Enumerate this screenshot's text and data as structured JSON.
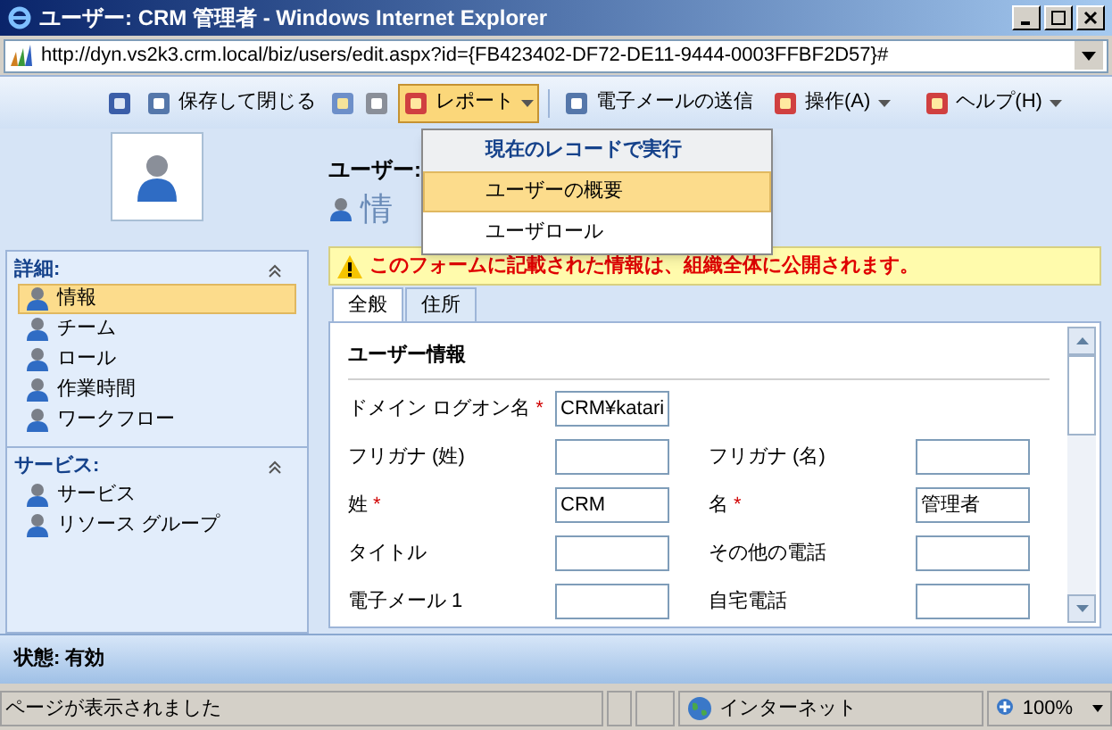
{
  "window": {
    "title": "ユーザー: CRM 管理者 - Windows Internet Explorer"
  },
  "address_bar": {
    "url": "http://dyn.vs2k3.crm.local/biz/users/edit.aspx?id={FB423402-DF72-DE11-9444-0003FFBF2D57}#"
  },
  "toolbar": {
    "items": [
      {
        "kind": "button",
        "label": "保存して閉じる",
        "active": false
      },
      {
        "kind": "dropdown",
        "label": "レポート",
        "active": true
      },
      {
        "kind": "button",
        "label": "電子メールの送信",
        "active": false
      },
      {
        "kind": "dropdown",
        "label": "操作(A)",
        "active": false
      },
      {
        "kind": "dropdown",
        "label": "ヘルプ(H)",
        "active": false
      }
    ]
  },
  "report_menu": {
    "items": [
      {
        "kind": "header",
        "label": "現在のレコードで実行",
        "selected": false
      },
      {
        "kind": "item",
        "label": "ユーザーの概要",
        "selected": true
      },
      {
        "kind": "item",
        "label": "ユーザロール",
        "selected": false
      }
    ]
  },
  "page_header": {
    "entity": "ユーザー:",
    "title": "情"
  },
  "sidebar": {
    "sections": [
      {
        "title": "詳細:",
        "items": [
          {
            "label": "情報",
            "selected": true
          },
          {
            "label": "チーム",
            "selected": false
          },
          {
            "label": "ロール",
            "selected": false
          },
          {
            "label": "作業時間",
            "selected": false
          },
          {
            "label": "ワークフロー",
            "selected": false
          }
        ]
      },
      {
        "title": "サービス:",
        "items": [
          {
            "label": "サービス",
            "selected": false
          },
          {
            "label": "リソース グループ",
            "selected": false
          }
        ]
      }
    ]
  },
  "notice": "このフォームに記載された情報は、組織全体に公開されます。",
  "form": {
    "tabs": [
      {
        "label": "全般",
        "selected": true
      },
      {
        "label": "住所",
        "selected": false
      }
    ],
    "section_title": "ユーザー情報",
    "rows": [
      [
        {
          "label": "ドメイン ログオン名",
          "mark": "*",
          "value": "CRM¥katari"
        }
      ],
      [
        {
          "label": "フリガナ (姓)"
        },
        {
          "label": "フリガナ (名)"
        }
      ],
      [
        {
          "label": "姓",
          "mark": "*",
          "value": "CRM"
        },
        {
          "label": "名",
          "mark": "*",
          "value": "管理者"
        }
      ],
      [
        {
          "label": "タイトル"
        },
        {
          "label": "その他の電話"
        }
      ],
      [
        {
          "label": "電子メール 1"
        },
        {
          "label": "自宅電話"
        }
      ]
    ]
  },
  "status": "状態: 有効",
  "ie_status": {
    "message": "ページが表示されました",
    "zone": "インターネット",
    "zoom": "100%"
  }
}
